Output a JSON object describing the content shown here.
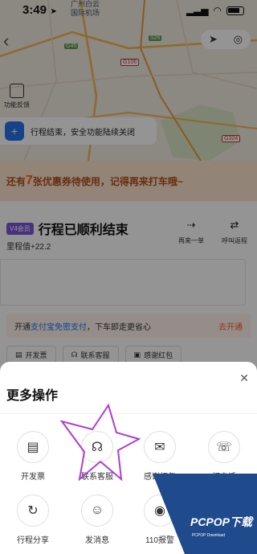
{
  "status_bar": {
    "time": "3:49",
    "arrow": "➤",
    "signal": "▂▃▅",
    "wifi": "◠"
  },
  "map": {
    "labels": [
      "广州白云",
      "国际机场"
    ],
    "roads": [
      "G45",
      "G106",
      "S26",
      "G324"
    ],
    "colors": {
      "base": "#f2ebe0",
      "road": "#f1b74e",
      "green": "#d9e6c5"
    }
  },
  "feedback": {
    "label": "功能反馈"
  },
  "safety_tip": {
    "text": "行程结束，安全功能陆续关闭"
  },
  "coupon": {
    "prefix": "还有",
    "count": "7",
    "suffix": "张优惠券待使用，记得再来打车哦~"
  },
  "trip": {
    "badge": "V4会员",
    "title": "行程已顺利结束",
    "mileage": "里程值+22.2",
    "actions": [
      {
        "icon": "⇢",
        "label": "再来一单"
      },
      {
        "icon": "⇄",
        "label": "呼叫返程"
      }
    ],
    "alipay": {
      "prefix": "开通",
      "link": "支付宝免密支付",
      "suffix": "，下车即走更省心",
      "open": "去开通"
    },
    "chips": [
      {
        "icon": "▤",
        "label": "开发票"
      },
      {
        "icon": "☊",
        "label": "联系客服"
      },
      {
        "icon": "▣",
        "label": "感谢红包"
      }
    ]
  },
  "sheet": {
    "title": "更多操作",
    "close_icon": "✕",
    "ops": [
      {
        "icon": "▤",
        "label": "开发票"
      },
      {
        "icon": "☊",
        "label": "联系客服"
      },
      {
        "icon": "✉",
        "label": "感谢红包"
      },
      {
        "icon": "☏",
        "label": "打电话"
      },
      {
        "icon": "↻",
        "label": "行程分享"
      },
      {
        "icon": "☺",
        "label": "发消息"
      },
      {
        "icon": "◉",
        "label": "110报警"
      }
    ]
  },
  "watermark": {
    "brand": "PCPOP下载",
    "sub": "PCPOP Download"
  }
}
